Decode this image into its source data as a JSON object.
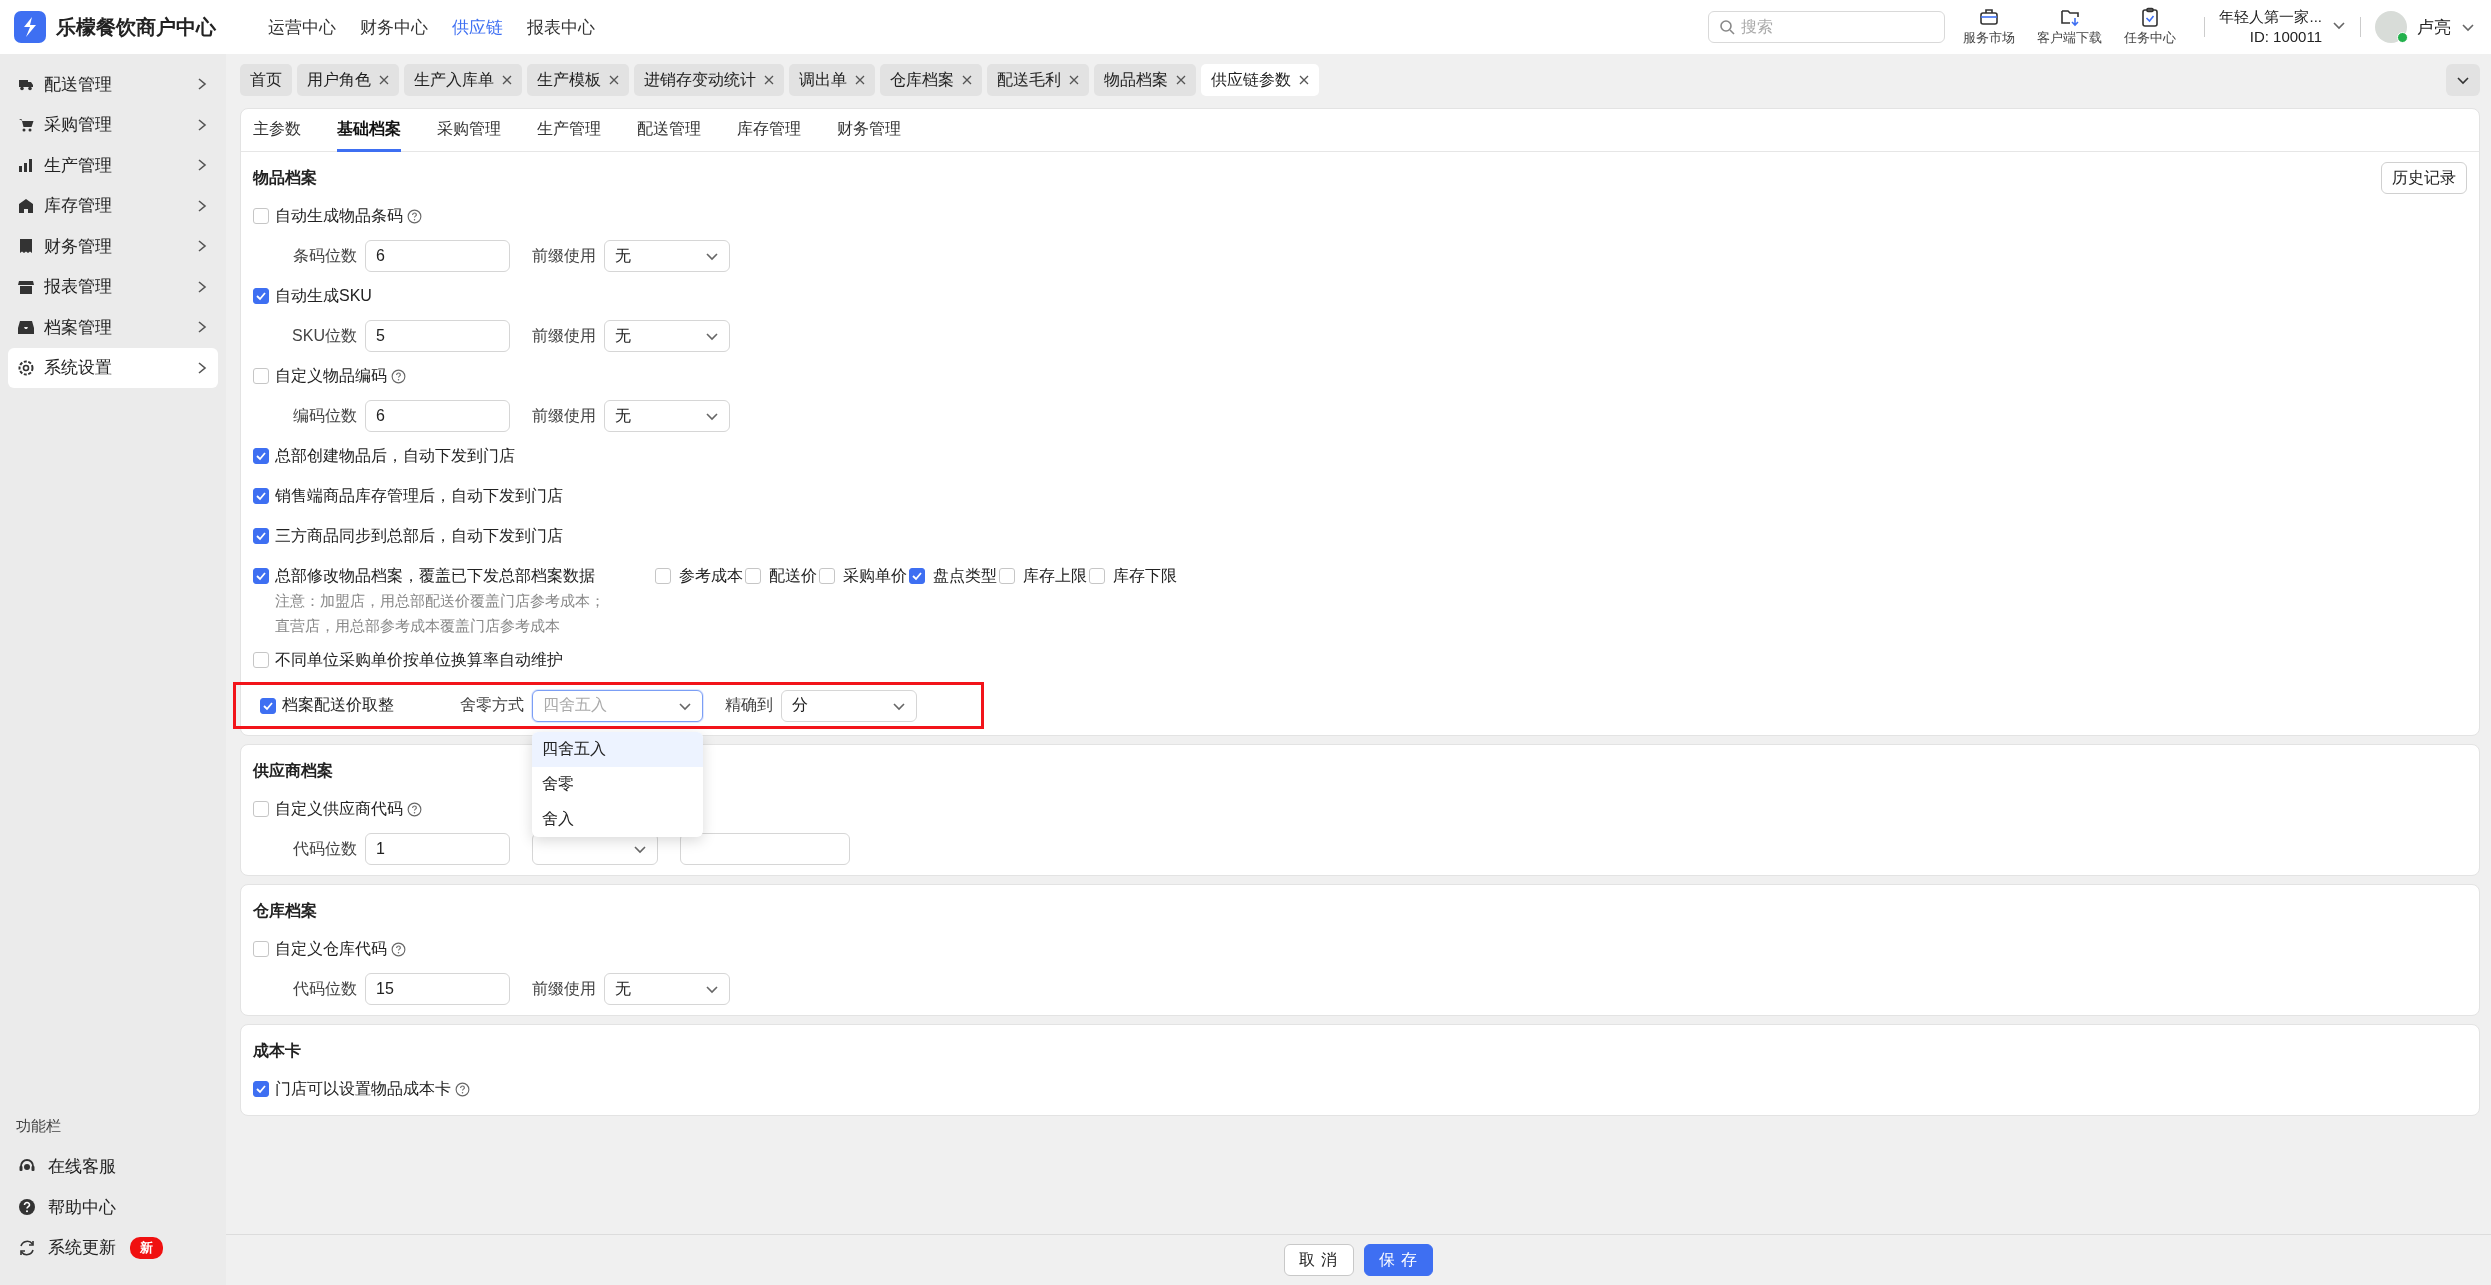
{
  "app": {
    "title": "乐檬餐饮商户中心"
  },
  "top_nav": [
    {
      "label": "运营中心",
      "selected": false
    },
    {
      "label": "财务中心",
      "selected": false
    },
    {
      "label": "供应链",
      "selected": true
    },
    {
      "label": "报表中心",
      "selected": false
    }
  ],
  "search": {
    "placeholder": "搜索"
  },
  "toolbar": [
    {
      "label": "服务市场"
    },
    {
      "label": "客户端下载"
    },
    {
      "label": "任务中心"
    }
  ],
  "account": {
    "company": "年轻人第一家...",
    "id": "ID: 100011"
  },
  "user": {
    "name": "卢亮"
  },
  "sidebar": {
    "items": [
      {
        "label": "配送管理",
        "selected": false
      },
      {
        "label": "采购管理",
        "selected": false
      },
      {
        "label": "生产管理",
        "selected": false
      },
      {
        "label": "库存管理",
        "selected": false
      },
      {
        "label": "财务管理",
        "selected": false
      },
      {
        "label": "报表管理",
        "selected": false
      },
      {
        "label": "档案管理",
        "selected": false
      },
      {
        "label": "系统设置",
        "selected": true
      }
    ],
    "footer_title": "功能栏",
    "footer_items": [
      {
        "label": "在线客服"
      },
      {
        "label": "帮助中心"
      },
      {
        "label": "系统更新",
        "badge": "新"
      }
    ]
  },
  "tabs": [
    {
      "label": "首页",
      "closable": false,
      "selected": false
    },
    {
      "label": "用户角色",
      "closable": true,
      "selected": false
    },
    {
      "label": "生产入库单",
      "closable": true,
      "selected": false
    },
    {
      "label": "生产模板",
      "closable": true,
      "selected": false
    },
    {
      "label": "进销存变动统计",
      "closable": true,
      "selected": false
    },
    {
      "label": "调出单",
      "closable": true,
      "selected": false
    },
    {
      "label": "仓库档案",
      "closable": true,
      "selected": false
    },
    {
      "label": "配送毛利",
      "closable": true,
      "selected": false
    },
    {
      "label": "物品档案",
      "closable": true,
      "selected": false
    },
    {
      "label": "供应链参数",
      "closable": true,
      "selected": true
    }
  ],
  "subtabs": [
    {
      "label": "主参数",
      "selected": false
    },
    {
      "label": "基础档案",
      "selected": true
    },
    {
      "label": "采购管理",
      "selected": false
    },
    {
      "label": "生产管理",
      "selected": false
    },
    {
      "label": "配送管理",
      "selected": false
    },
    {
      "label": "库存管理",
      "selected": false
    },
    {
      "label": "财务管理",
      "selected": false
    }
  ],
  "sections": [
    {
      "title": "物品档案",
      "action": "历史记录",
      "rows": [
        {
          "kind": "checkbox",
          "label": "自动生成物品条码",
          "checked": false,
          "help": true
        },
        {
          "kind": "fields",
          "fields": [
            {
              "kind": "input",
              "label": "条码位数",
              "value": "6"
            },
            {
              "kind": "select",
              "label": "前缀使用",
              "value": "无"
            }
          ]
        },
        {
          "kind": "checkbox",
          "label": "自动生成SKU",
          "checked": true,
          "help": false
        },
        {
          "kind": "fields",
          "fields": [
            {
              "kind": "input",
              "label": "SKU位数",
              "value": "5"
            },
            {
              "kind": "select",
              "label": "前缀使用",
              "value": "无"
            }
          ]
        },
        {
          "kind": "checkbox",
          "label": "自定义物品编码",
          "checked": false,
          "help": true
        },
        {
          "kind": "fields",
          "fields": [
            {
              "kind": "input",
              "label": "编码位数",
              "value": "6"
            },
            {
              "kind": "select",
              "label": "前缀使用",
              "value": "无"
            }
          ]
        },
        {
          "kind": "checkbox",
          "label": "总部创建物品后，自动下发到门店",
          "checked": true,
          "help": false
        },
        {
          "kind": "checkbox",
          "label": "销售端商品库存管理后，自动下发到门店",
          "checked": true,
          "help": false
        },
        {
          "kind": "checkbox",
          "label": "三方商品同步到总部后，自动下发到门店",
          "checked": true,
          "help": false
        },
        {
          "kind": "checkbox_options",
          "label": "总部修改物品档案，覆盖已下发总部档案数据",
          "checked": true,
          "options": [
            {
              "label": "参考成本",
              "checked": false
            },
            {
              "label": "配送价",
              "checked": false
            },
            {
              "label": "采购单价",
              "checked": false
            },
            {
              "label": "盘点类型",
              "checked": true
            },
            {
              "label": "库存上限",
              "checked": false
            },
            {
              "label": "库存下限",
              "checked": false
            }
          ],
          "notes": [
            "注意：加盟店，用总部配送价覆盖门店参考成本；",
            "直营店，用总部参考成本覆盖门店参考成本"
          ]
        },
        {
          "kind": "checkbox",
          "label": "不同单位采购单价按单位换算率自动维护",
          "checked": false,
          "help": false
        },
        {
          "kind": "rounding",
          "label": "档案配送价取整",
          "checked": true,
          "highlighted": true,
          "fields": [
            {
              "kind": "select",
              "label": "舍零方式",
              "value": "四舍五入",
              "open": true
            },
            {
              "kind": "select",
              "label": "精确到",
              "value": "分"
            }
          ],
          "dropdown": [
            {
              "label": "四舍五入",
              "selected": true
            },
            {
              "label": "舍零",
              "selected": false
            },
            {
              "label": "舍入",
              "selected": false
            }
          ]
        }
      ]
    },
    {
      "title": "供应商档案",
      "rows": [
        {
          "kind": "checkbox",
          "label": "自定义供应商代码",
          "checked": false,
          "help": true
        },
        {
          "kind": "fields",
          "fields": [
            {
              "kind": "input",
              "label": "代码位数",
              "value": "1"
            },
            {
              "kind": "select"
            },
            {
              "kind": "input"
            }
          ]
        }
      ]
    },
    {
      "title": "仓库档案",
      "rows": [
        {
          "kind": "checkbox",
          "label": "自定义仓库代码",
          "checked": false,
          "help": true
        },
        {
          "kind": "fields",
          "fields": [
            {
              "kind": "input",
              "label": "代码位数",
              "value": "15"
            },
            {
              "kind": "select",
              "label": "前缀使用",
              "value": "无"
            }
          ]
        }
      ]
    },
    {
      "title": "成本卡",
      "rows": [
        {
          "kind": "checkbox",
          "label": "门店可以设置物品成本卡",
          "checked": true,
          "help": true
        }
      ]
    }
  ],
  "footer": {
    "buttons": [
      {
        "label": "取 消",
        "kind": "secondary"
      },
      {
        "label": "保 存",
        "kind": "primary"
      }
    ]
  }
}
